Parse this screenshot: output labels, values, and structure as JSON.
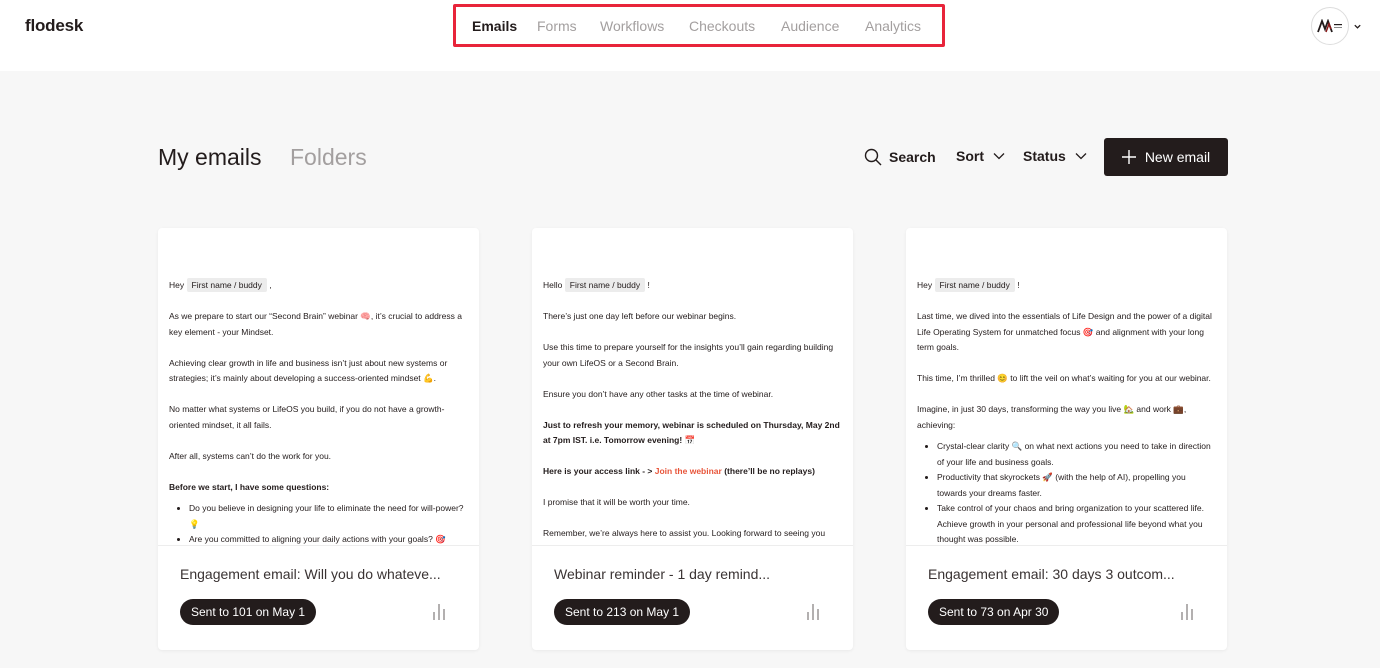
{
  "header": {
    "logo": "flodesk",
    "nav": [
      "Emails",
      "Forms",
      "Workflows",
      "Checkouts",
      "Audience",
      "Analytics"
    ],
    "active_nav": "Emails",
    "highlight_color": "#e8243a"
  },
  "toolbar": {
    "tab_my_emails": "My emails",
    "tab_folders": "Folders",
    "search": "Search",
    "sort": "Sort",
    "status": "Status",
    "new_email": "New email"
  },
  "colors": {
    "primary": "#231c1c",
    "muted": "#a39f9f",
    "link": "#e8553a",
    "background": "#f7f7f7"
  },
  "cards": [
    {
      "greeting": "Hey",
      "merge_tag": "First name / buddy",
      "greeting_end": ",",
      "body": [
        "As we prepare to start our “Second Brain” webinar 🧠, it’s crucial to address a key element - your Mindset.",
        "Achieving clear growth in life and business isn’t just about new systems or strategies; it’s mainly about developing a success-oriented mindset 💪.",
        "No matter what systems or LifeOS you build, if you do not have a growth-oriented mindset, it all fails.",
        "After all, systems can’t do the work for you."
      ],
      "bold": "Before we start, I have some questions:",
      "bullets": [
        "Do you believe in designing your life to eliminate the need for will-power? 💡",
        "Are you committed to aligning your daily actions with your goals? 🎯"
      ],
      "title": "Engagement email: Will you do whateve...",
      "badge": "Sent to 101 on May 1"
    },
    {
      "greeting": "Hello",
      "merge_tag": "First name / buddy",
      "greeting_end": "!",
      "body": [
        "There’s just one day left before our webinar begins.",
        "Use this time to prepare yourself for the insights you’ll gain regarding building your own LifeOS or a Second Brain.",
        "Ensure you don’t have any other tasks at the time of webinar."
      ],
      "bold": "Just to refresh your memory, webinar is scheduled on Thursday, May 2nd at 7pm IST. i.e. Tomorrow evening! 📅",
      "access_prefix": "Here is your access link - >",
      "access_link": "Join the webinar",
      "access_suffix": "(there’ll be no replays)",
      "body_after": [
        "I promise that it will be worth your time.",
        "Remember, we’re always here to assist you. Looking forward to seeing you"
      ],
      "title": "Webinar reminder - 1 day remind...",
      "badge": "Sent to 213 on May 1"
    },
    {
      "greeting": "Hey",
      "merge_tag": "First name / buddy",
      "greeting_end": "!",
      "body": [
        "Last time, we dived into the essentials of Life Design and the power of a digital Life Operating System for unmatched focus 🎯 and alignment with your long term goals.",
        "This time, I’m thrilled 😊 to lift the veil on what’s waiting for you at our webinar.",
        "Imagine, in just 30 days, transforming the way you live 🏡 and work 💼, achieving:"
      ],
      "bullets": [
        "Crystal-clear clarity 🔍 on what next actions you need to take in direction of your life and business goals.",
        "Productivity that skyrockets 🚀 (with the help of AI), propelling you towards your dreams faster.",
        "Take control of your chaos and bring organization to your scattered life. Achieve growth in your personal and professional life beyond what you thought was possible."
      ],
      "title": "Engagement email: 30 days 3 outcom...",
      "badge": "Sent to 73 on Apr 30"
    }
  ]
}
